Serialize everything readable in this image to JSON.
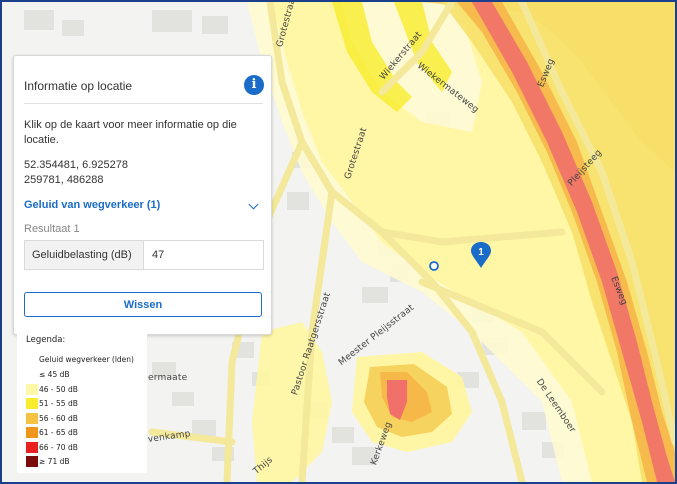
{
  "panel": {
    "title": "Informatie op locatie",
    "help_text": "Klik op de kaart voor meer informatie op die locatie.",
    "coords_wgs84": "52.354481, 6.925278",
    "coords_rd": "259781, 486288",
    "layer_title": "Geluid van wegverkeer (1)",
    "result_label": "Resultaat 1",
    "result_key": "Geluidbelasting (dB)",
    "result_value": "47",
    "clear_button": "Wissen"
  },
  "legend": {
    "title": "Legenda:",
    "subtitle": "Geluid wegverkeer (lden)",
    "items": [
      {
        "label": "≤ 45 dB",
        "color": "#ffffff"
      },
      {
        "label": "46 - 50 dB",
        "color": "#fff8a8"
      },
      {
        "label": "51 - 55 dB",
        "color": "#f8ec2c"
      },
      {
        "label": "56 - 60 dB",
        "color": "#f5c242"
      },
      {
        "label": "61 - 65 dB",
        "color": "#f0961a"
      },
      {
        "label": "66 - 70 dB",
        "color": "#e8201e"
      },
      {
        "label": "≥ 71 dB",
        "color": "#7a0c0c"
      }
    ]
  },
  "map": {
    "marker_label": "1",
    "streets": {
      "grotestraat_top": "Grotestraat",
      "grotestraat_mid": "Grotestraat",
      "wiekerstraat": "Wiekerstraat",
      "wiekermateweg": "Wiekermateweg",
      "esweg_top": "Esweg",
      "pleijsteeg": "Pleijsteeg",
      "esweg_bottom": "Esweg",
      "pastoor": "Pastoor Raatgersstraat",
      "meester": "Meester Pleijsstraat",
      "de_leemboer": "De Leemboer",
      "kerkeweg": "Kerkeweg",
      "venkamp": "venkamp",
      "ermaate": "ermaate",
      "thijs": "Thijs"
    }
  },
  "colors": {
    "accent": "#1a6cc8",
    "frame": "#1c3f8c"
  }
}
